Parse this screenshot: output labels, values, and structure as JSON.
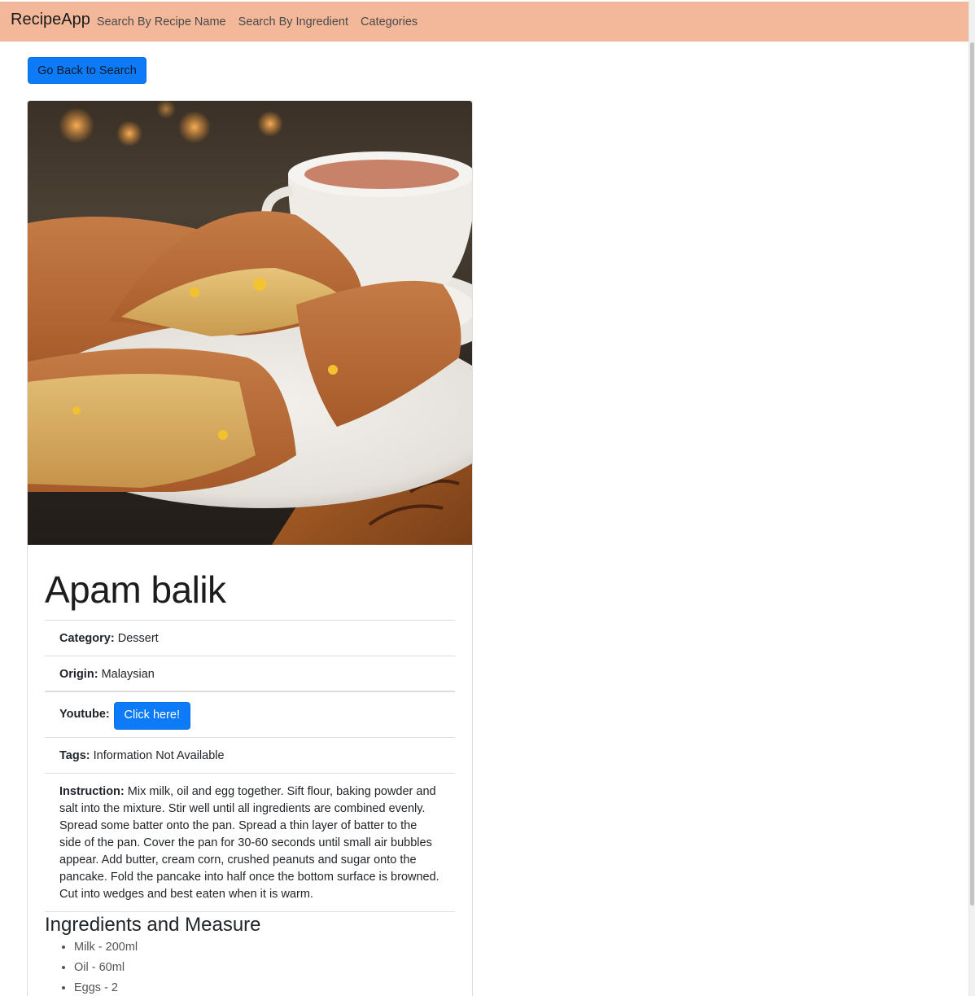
{
  "navbar": {
    "brand": "RecipeApp",
    "links": [
      "Search By Recipe Name",
      "Search By Ingredient",
      "Categories"
    ]
  },
  "back_button": "Go Back to Search",
  "recipe": {
    "title": "Apam balik",
    "category_label": "Category:",
    "category": "Dessert",
    "origin_label": "Origin:",
    "origin": "Malaysian",
    "youtube_label": "Youtube:",
    "youtube_button": "Click here!",
    "tags_label": "Tags:",
    "tags": "Information Not Available",
    "instruction_label": "Instruction:",
    "instruction": "Mix milk, oil and egg together. Sift flour, baking powder and salt into the mixture. Stir well until all ingredients are combined evenly. Spread some batter onto the pan. Spread a thin layer of batter to the side of the pan. Cover the pan for 30-60 seconds until small air bubbles appear. Add butter, cream corn, crushed peanuts and sugar onto the pancake. Fold the pancake into half once the bottom surface is browned. Cut into wedges and best eaten when it is warm.",
    "ingredients_heading": "Ingredients and Measure",
    "ingredients": [
      "Milk - 200ml",
      "Oil - 60ml",
      "Eggs - 2"
    ]
  },
  "colors": {
    "navbar_bg": "#f3b799",
    "primary": "#0d7bf7"
  }
}
